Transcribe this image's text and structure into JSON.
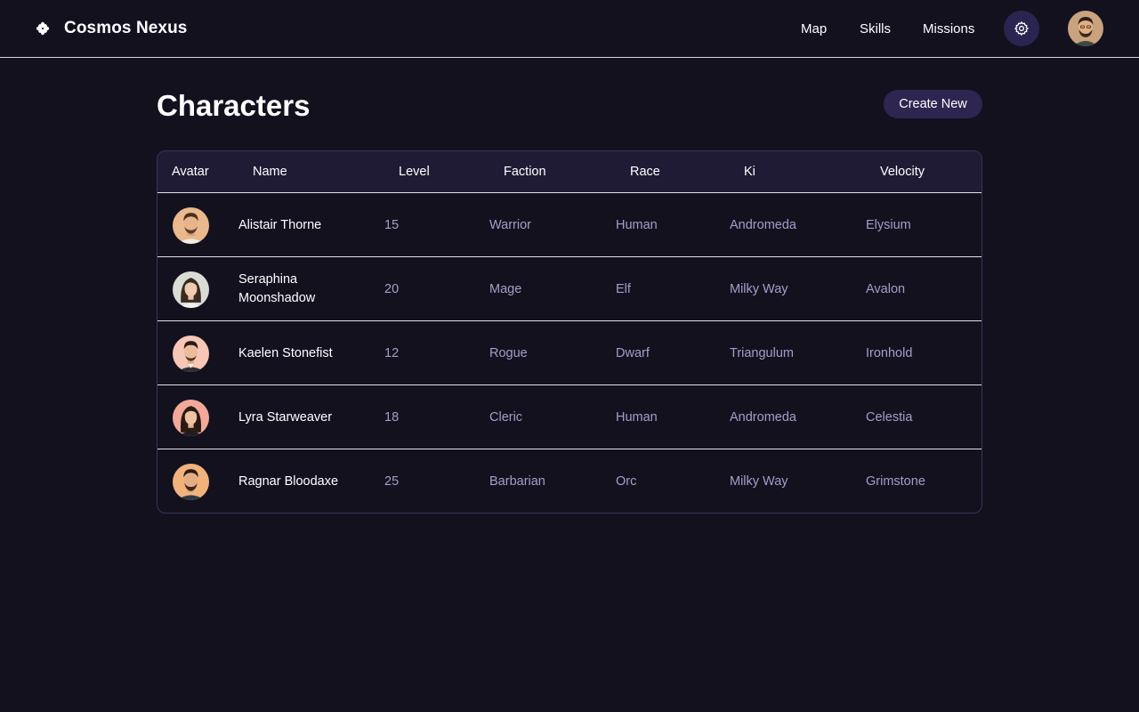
{
  "app": {
    "title": "Cosmos Nexus",
    "logo_icon": "asterisk-icon"
  },
  "nav": {
    "map": "Map",
    "skills": "Skills",
    "missions": "Missions",
    "settings_icon": "gear-icon"
  },
  "page": {
    "title": "Characters",
    "create_label": "Create New"
  },
  "table": {
    "headers": [
      "Avatar",
      "Name",
      "Level",
      "Faction",
      "Race",
      "Ki",
      "Velocity"
    ],
    "rows": [
      {
        "name": "Alistair Thorne",
        "level": "15",
        "faction": "Warrior",
        "race": "Human",
        "ki": "Andromeda",
        "velocity": "Elysium"
      },
      {
        "name": "Seraphina Moonshadow",
        "level": "20",
        "faction": "Mage",
        "race": "Elf",
        "ki": "Milky Way",
        "velocity": "Avalon"
      },
      {
        "name": "Kaelen Stonefist",
        "level": "12",
        "faction": "Rogue",
        "race": "Dwarf",
        "ki": "Triangulum",
        "velocity": "Ironhold"
      },
      {
        "name": "Lyra Starweaver",
        "level": "18",
        "faction": "Cleric",
        "race": "Human",
        "ki": "Andromeda",
        "velocity": "Celestia"
      },
      {
        "name": "Ragnar Bloodaxe",
        "level": "25",
        "faction": "Barbarian",
        "race": "Orc",
        "ki": "Milky Way",
        "velocity": "Grimstone"
      }
    ]
  },
  "colors": {
    "background": "#14111f",
    "header_bg": "#201b35",
    "button_bg": "#2e2650",
    "muted_text": "#a69dc8"
  }
}
